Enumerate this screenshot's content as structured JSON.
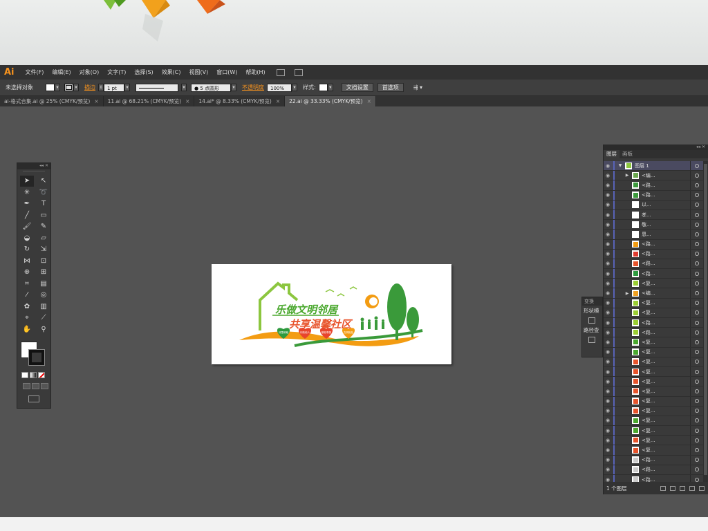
{
  "app": {
    "logo": "Ai"
  },
  "menu": [
    "文件(F)",
    "编辑(E)",
    "对象(O)",
    "文字(T)",
    "选择(S)",
    "效果(C)",
    "视图(V)",
    "窗口(W)",
    "帮助(H)"
  ],
  "control": {
    "selection_status": "未选择对象",
    "stroke_label": "描边",
    "stroke_weight": "1 pt",
    "stroke_profile": "等比",
    "brush": "● 5 点圆形",
    "opacity_label": "不透明度",
    "opacity_value": "100%",
    "style_label": "样式:",
    "doc_setup": "文档设置",
    "preferences": "首选项"
  },
  "tabs": [
    {
      "label": "ai-格式合集.ai @ 25% (CMYK/预览)",
      "close": "×"
    },
    {
      "label": "11.ai @ 68.21% (CMYK/预览)",
      "close": "×"
    },
    {
      "label": "14.ai* @ 8.33% (CMYK/预览)",
      "close": "×"
    },
    {
      "label": "22.ai @ 33.33% (CMYK/预览)",
      "close": "×"
    }
  ],
  "artwork": {
    "headline1": "乐做文明邻居",
    "headline2": "共享温馨社区",
    "heart_labels": [
      "邻里和睦",
      "乐助他人",
      "敬老尊贤",
      "文明相处"
    ],
    "colors": {
      "green": "#4aa82e",
      "orange": "#f39c12",
      "red": "#e8452c"
    }
  },
  "layers_panel": {
    "tab_layers": "图层",
    "tab_artboards": "画板",
    "top_layer": "图层 1",
    "rows": [
      {
        "name": "<编...",
        "color": "#6aa84f",
        "expand": true
      },
      {
        "name": "<路...",
        "color": "#3c9a3c",
        "expand": false
      },
      {
        "name": "<路...",
        "color": "#3c9a3c",
        "expand": false
      },
      {
        "name": "以...",
        "color": "#ffffff",
        "expand": false
      },
      {
        "name": "孝...",
        "color": "#ffffff",
        "expand": false
      },
      {
        "name": "敬...",
        "color": "#ffffff",
        "expand": false
      },
      {
        "name": "恩...",
        "color": "#ffffff",
        "expand": false
      },
      {
        "name": "<路...",
        "color": "#f39c12",
        "expand": false
      },
      {
        "name": "<路...",
        "color": "#e03a2f",
        "expand": false
      },
      {
        "name": "<路...",
        "color": "#e8542c",
        "expand": false
      },
      {
        "name": "<路...",
        "color": "#2e9a3e",
        "expand": false
      },
      {
        "name": "<复...",
        "color": "#9acd32",
        "expand": false
      },
      {
        "name": "<编...",
        "color": "#f0a020",
        "expand": true
      },
      {
        "name": "<复...",
        "color": "#9acd32",
        "expand": false
      },
      {
        "name": "<复...",
        "color": "#9acd32",
        "expand": false
      },
      {
        "name": "<路...",
        "color": "#9acd32",
        "expand": false
      },
      {
        "name": "<路...",
        "color": "#9acd32",
        "expand": false
      },
      {
        "name": "<复...",
        "color": "#4aa82e",
        "expand": false
      },
      {
        "name": "<复...",
        "color": "#4aa82e",
        "expand": false
      },
      {
        "name": "<复...",
        "color": "#e8542c",
        "expand": false
      },
      {
        "name": "<复...",
        "color": "#e8542c",
        "expand": false
      },
      {
        "name": "<复...",
        "color": "#e8542c",
        "expand": false
      },
      {
        "name": "<复...",
        "color": "#e8542c",
        "expand": false
      },
      {
        "name": "<复...",
        "color": "#e8542c",
        "expand": false
      },
      {
        "name": "<复...",
        "color": "#e8542c",
        "expand": false
      },
      {
        "name": "<复...",
        "color": "#4aa82e",
        "expand": false
      },
      {
        "name": "<复...",
        "color": "#4aa82e",
        "expand": false
      },
      {
        "name": "<复...",
        "color": "#e8542c",
        "expand": false
      },
      {
        "name": "<复...",
        "color": "#e8542c",
        "expand": false
      },
      {
        "name": "<路...",
        "color": "#cccccc",
        "expand": false
      },
      {
        "name": "<路...",
        "color": "#cccccc",
        "expand": false
      },
      {
        "name": "<路...",
        "color": "#cccccc",
        "expand": false
      }
    ],
    "footer": "1 个图层"
  },
  "mini_panel": {
    "tab": "变换",
    "shape": "形状模",
    "pathfinder": "路径查"
  }
}
